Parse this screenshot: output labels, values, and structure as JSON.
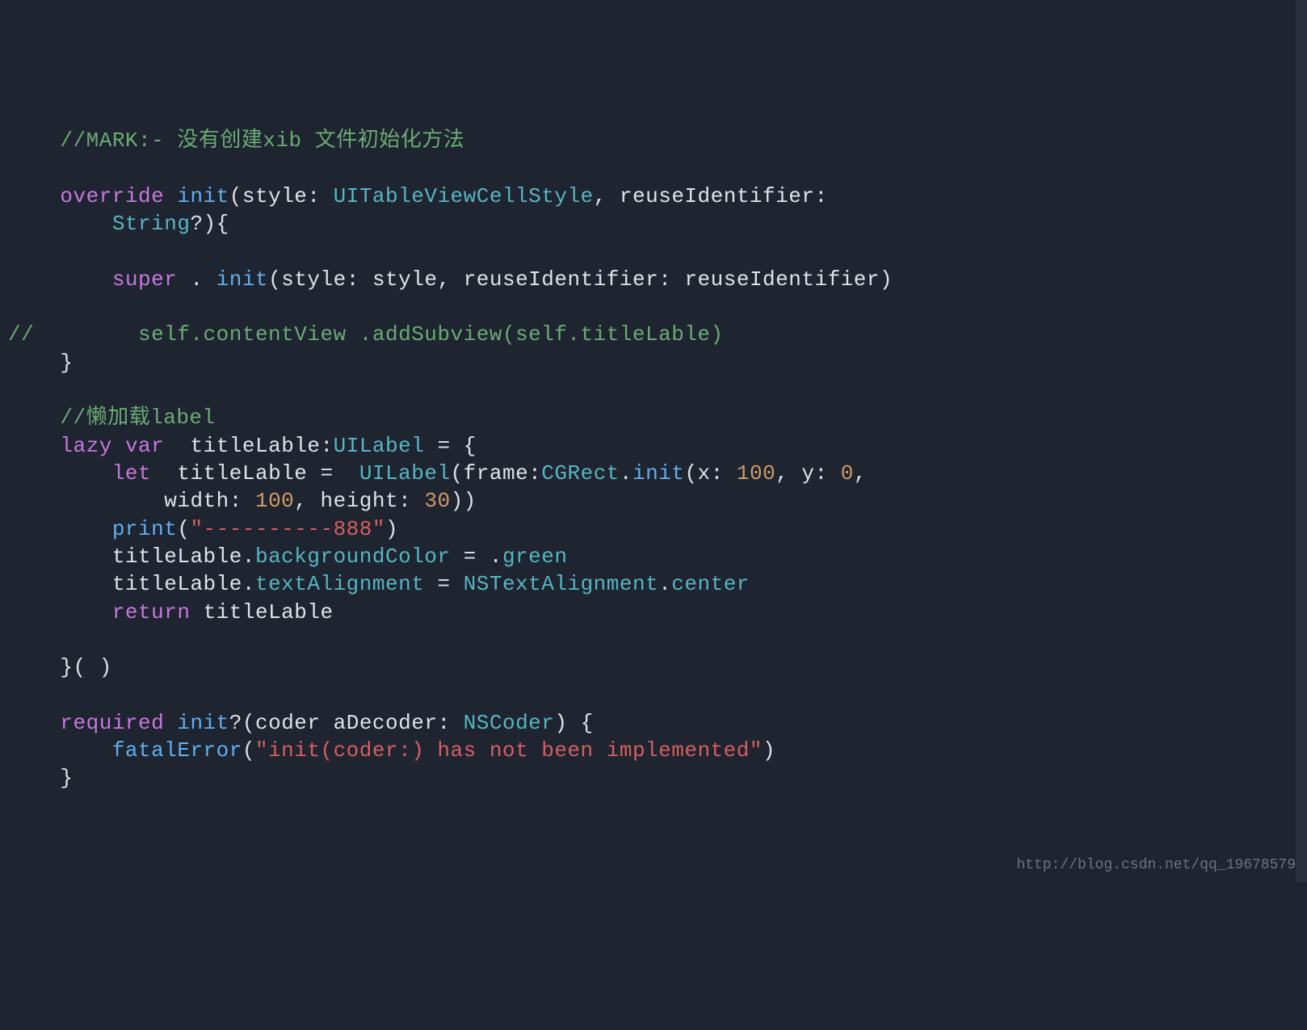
{
  "code": {
    "c_mark": "//MARK:- 没有创建xib 文件初始化方法",
    "kw_override": "override",
    "kw_init": "init",
    "p_style": "style",
    "t_cellstyle": "UITableViewCellStyle",
    "p_reuse": "reuseIdentifier",
    "t_string": "String",
    "kw_super": "super",
    "l_style": "style",
    "l_reuse": "reuseIdentifier",
    "c_self_line": "//        self.contentView .addSubview(self.titleLable)",
    "c_lazy": "//懒加载label",
    "kw_lazy": "lazy",
    "kw_var": "var",
    "id_titleLable": "titleLable",
    "t_uilabel": "UILabel",
    "kw_let": "let",
    "p_frame": "frame",
    "t_cgrect": "CGRect",
    "m_init": "init",
    "p_x": "x",
    "n_100a": "100",
    "p_y": "y",
    "n_0": "0",
    "p_width": "width",
    "n_100b": "100",
    "p_height": "height",
    "n_30": "30",
    "fn_print": "print",
    "s_888": "\"----------888\"",
    "prop_bg": "backgroundColor",
    "v_green": "green",
    "prop_align": "textAlignment",
    "t_nsalign": "NSTextAlignment",
    "v_center": "center",
    "kw_return": "return",
    "kw_required": "required",
    "p_coder": "coder",
    "l_adecoder": "aDecoder",
    "t_nscoder": "NSCoder",
    "fn_fatal": "fatalError",
    "s_fatal": "\"init(coder:) has not been implemented\""
  },
  "watermark": "http://blog.csdn.net/qq_19678579"
}
